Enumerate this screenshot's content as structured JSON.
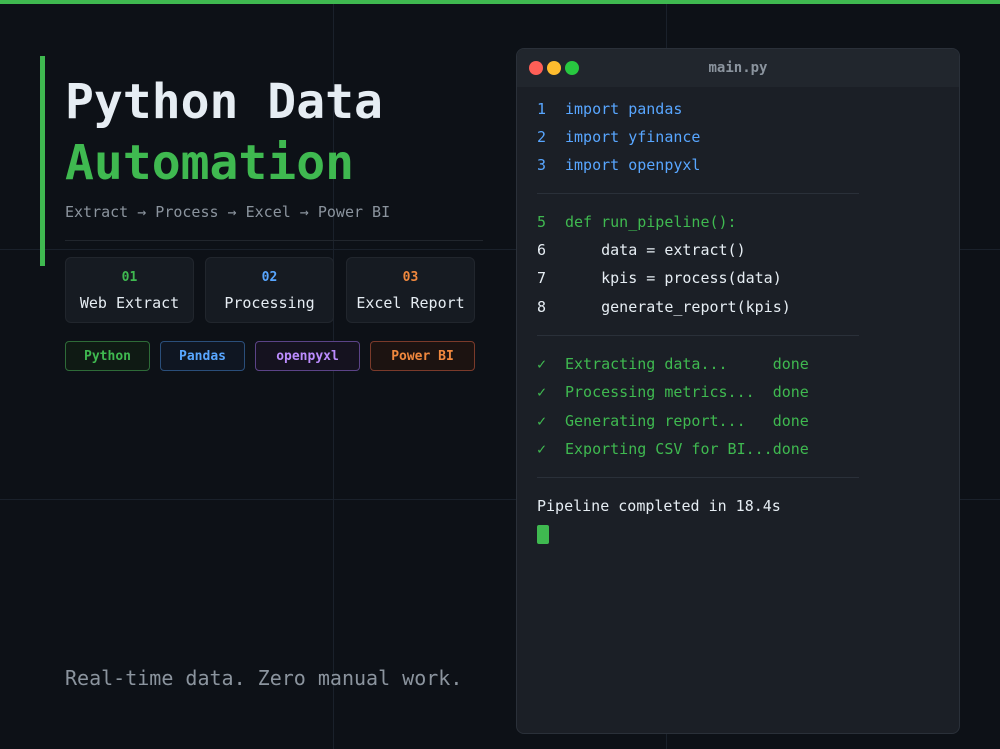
{
  "colors": {
    "accent_green": "#3fb950",
    "accent_blue": "#58a6ff",
    "accent_purple": "#bc8cff",
    "accent_red": "#f0883e",
    "background": "#0d1117"
  },
  "header": {
    "title_line1": "Python Data",
    "title_line2": "Automation",
    "subtitle": "Extract → Process → Excel → Power BI"
  },
  "steps": [
    {
      "num": "01",
      "label": "Web Extract",
      "color": "#3fb950"
    },
    {
      "num": "02",
      "label": "Processing",
      "color": "#58a6ff"
    },
    {
      "num": "03",
      "label": "Excel Report",
      "color": "#f0883e"
    }
  ],
  "tags": [
    {
      "label": "Python",
      "color": "#3fb950"
    },
    {
      "label": "Pandas",
      "color": "#58a6ff"
    },
    {
      "label": "openpyxl",
      "color": "#bc8cff"
    },
    {
      "label": "Power BI",
      "color": "#f0883e"
    }
  ],
  "tagline": "Real-time data. Zero manual work.",
  "editor": {
    "filename": "main.py",
    "window_buttons": [
      "close-icon",
      "minimize-icon",
      "maximize-icon"
    ],
    "imports": [
      {
        "n": "1",
        "code": "import pandas"
      },
      {
        "n": "2",
        "code": "import yfinance"
      },
      {
        "n": "3",
        "code": "import openpyxl"
      }
    ],
    "func_def": {
      "n": "5",
      "code": "def run_pipeline():"
    },
    "body": [
      {
        "n": "6",
        "code": "    data = extract()"
      },
      {
        "n": "7",
        "code": "    kpis = process(data)"
      },
      {
        "n": "8",
        "code": "    generate_report(kpis)"
      }
    ],
    "status": [
      {
        "check": "✓",
        "text": "Extracting data...     done"
      },
      {
        "check": "✓",
        "text": "Processing metrics...  done"
      },
      {
        "check": "✓",
        "text": "Generating report...   done"
      },
      {
        "check": "✓",
        "text": "Exporting CSV for BI...done"
      }
    ],
    "completion": "Pipeline completed in 18.4s"
  }
}
